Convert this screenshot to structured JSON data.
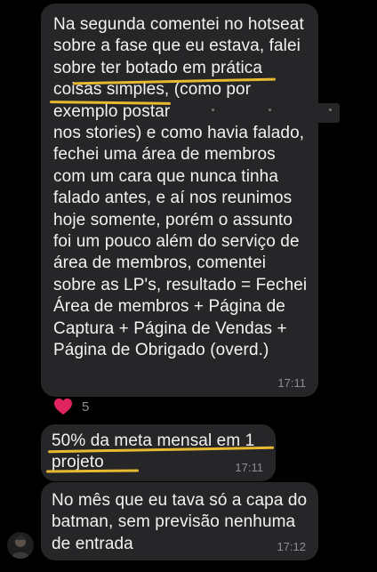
{
  "messages": [
    {
      "text": "Na segunda comentei no hotseat\nsobre a fase que eu estava, falei\nsobre ter botado em prática\ncoisas simples, (como por\nexemplo postar\nnos stories) e como havia falado,\nfechei uma área de membros\ncom um cara que nunca tinha\nfalado antes, e aí nos reunimos\nhoje somente, porém o assunto\nfoi um pouco além do serviço de\nárea de membros, comentei\nsobre as LP's, resultado = Fechei\nÁrea de membros + Página de\nCaptura + Página de Vendas +\nPágina de Obrigado (overd.)",
      "time": "17:11",
      "reaction": {
        "icon": "heart-icon",
        "count": "5"
      }
    },
    {
      "text": "50% da meta mensal em 1\nprojeto",
      "time": "17:11"
    },
    {
      "text": "No mês que eu tava só a capa do\nbatman, sem previsão nenhuma\nde entrada",
      "time": "17:12"
    }
  ],
  "colors": {
    "background": "#000000",
    "bubble": "#262628",
    "text": "#f2f2f2",
    "timestamp": "#8e8e93",
    "highlight_underline": "#e7b931",
    "heart": "#e0245e"
  }
}
